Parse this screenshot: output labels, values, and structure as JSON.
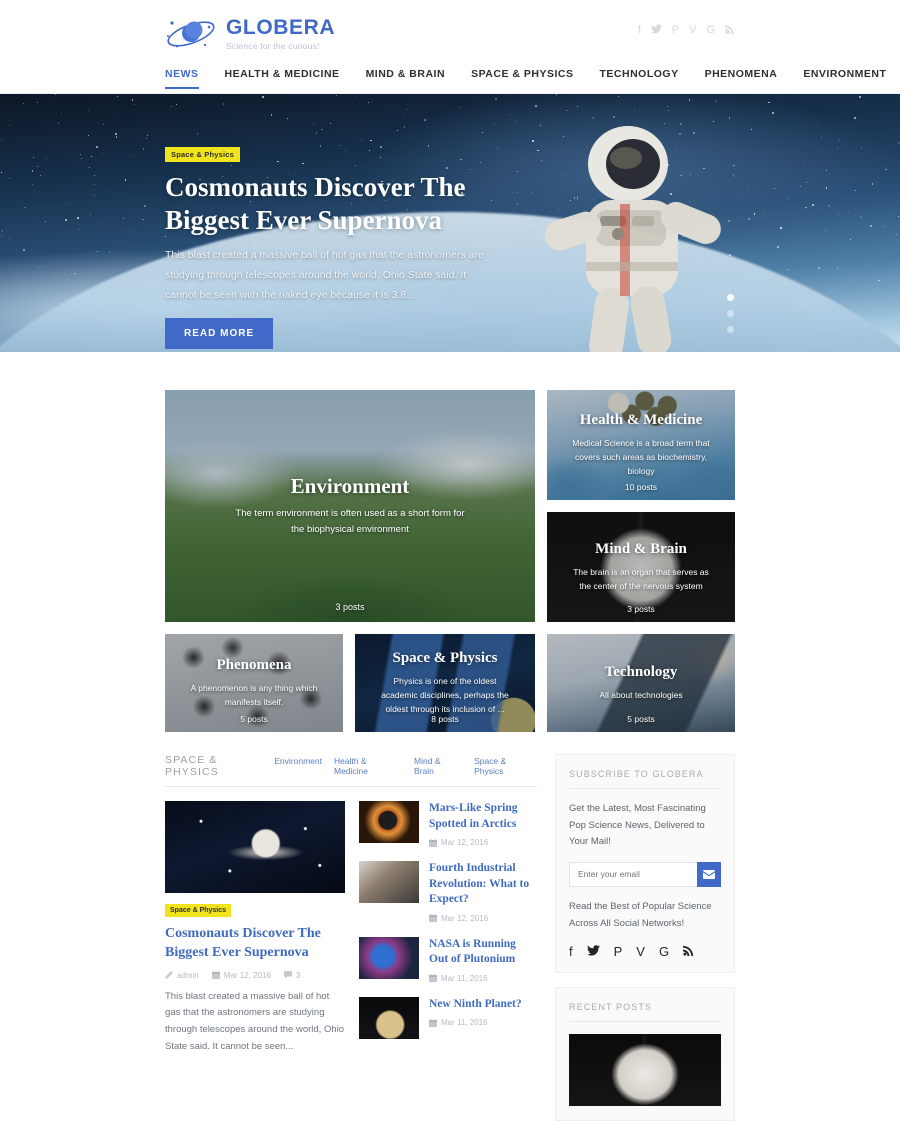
{
  "brand": {
    "name": "GLOBERA",
    "tagline": "Science for the curious!"
  },
  "header": {
    "social": [
      {
        "name": "facebook-icon",
        "glyph": "f"
      },
      {
        "name": "twitter-icon",
        "glyph": "🐦"
      },
      {
        "name": "pinterest-icon",
        "glyph": "P"
      },
      {
        "name": "vimeo-icon",
        "glyph": "V"
      },
      {
        "name": "googleplus-icon",
        "glyph": "G"
      },
      {
        "name": "rss-icon",
        "glyph": "⏺"
      }
    ]
  },
  "nav": {
    "items": [
      {
        "label": "NEWS",
        "active": true
      },
      {
        "label": "HEALTH & MEDICINE",
        "active": false
      },
      {
        "label": "MIND & BRAIN",
        "active": false
      },
      {
        "label": "SPACE & PHYSICS",
        "active": false
      },
      {
        "label": "TECHNOLOGY",
        "active": false
      },
      {
        "label": "PHENOMENA",
        "active": false
      },
      {
        "label": "ENVIRONMENT",
        "active": false
      }
    ]
  },
  "hero": {
    "badge": "Space & Physics",
    "title": "Cosmonauts Discover The Biggest Ever Supernova",
    "description": "This blast created a massive ball of hot gas that the astronomers are studying through telescopes around the world, Ohio State said. It cannot be seen with the naked eye because it is 3.8...",
    "button": "READ MORE",
    "slides": 3,
    "active_slide": 1
  },
  "categories": [
    {
      "title": "Environment",
      "description": "The term environment is often used as a short form for the biophysical environment",
      "count": "3 posts"
    },
    {
      "title": "Health & Medicine",
      "description": "Medical Science is a broad term that covers such areas as biochemistry, biology",
      "count": "10 posts"
    },
    {
      "title": "Mind & Brain",
      "description": "The brain is an organ that serves as the center of the nervous system",
      "count": "3 posts"
    },
    {
      "title": "Phenomena",
      "description": "A phenomenon is any thing which manifests itself.",
      "count": "5 posts"
    },
    {
      "title": "Space & Physics",
      "description": "Physics is one of the oldest academic disciplines, perhaps the oldest through its inclusion of ...",
      "count": "8 posts"
    },
    {
      "title": "Technology",
      "description": "All about technologies",
      "count": "5 posts"
    }
  ],
  "section": {
    "title": "SPACE & PHYSICS",
    "tabs": [
      "Environment",
      "Health & Medicine",
      "Mind & Brain",
      "Space & Physics"
    ]
  },
  "feature": {
    "badge": "Space & Physics",
    "title": "Cosmonauts Discover The Biggest Ever Supernova",
    "author": "admin",
    "date": "Mar 12, 2016",
    "comments": "3",
    "excerpt": "This blast created a massive ball of hot gas that the astronomers are studying through telescopes around the world, Ohio State said. It cannot be seen..."
  },
  "posts": [
    {
      "title": "Mars-Like Spring Spotted in Arctics",
      "date": "Mar 12, 2016"
    },
    {
      "title": "Fourth Industrial Revolution: What to Expect?",
      "date": "Mar 12, 2016"
    },
    {
      "title": "NASA is Running Out of Plutonium",
      "date": "Mar 11, 2016"
    },
    {
      "title": "New Ninth Planet?",
      "date": "Mar 11, 2016"
    }
  ],
  "sidebar": {
    "subscribe": {
      "title": "SUBSCRIBE TO GLOBERA",
      "text": "Get the Latest, Most Fascinating Pop Science News, Delivered to Your Mail!",
      "placeholder": "Enter your email",
      "input_value": "",
      "submit_icon": "envelope-icon",
      "social_text": "Read the Best of Popular Science Across All Social Networks!",
      "social": [
        {
          "name": "facebook-icon",
          "glyph": "f"
        },
        {
          "name": "twitter-icon",
          "glyph": "🐦"
        },
        {
          "name": "pinterest-icon",
          "glyph": "P"
        },
        {
          "name": "vimeo-icon",
          "glyph": "V"
        },
        {
          "name": "googleplus-icon",
          "glyph": "G"
        },
        {
          "name": "rss-icon",
          "glyph": "⏺"
        }
      ]
    },
    "recent": {
      "title": "RECENT POSTS"
    }
  },
  "colors": {
    "accent": "#4169c9",
    "link": "#3f6bbf",
    "badge_yellow": "#f2e41c",
    "muted": "#9aa0a8"
  }
}
